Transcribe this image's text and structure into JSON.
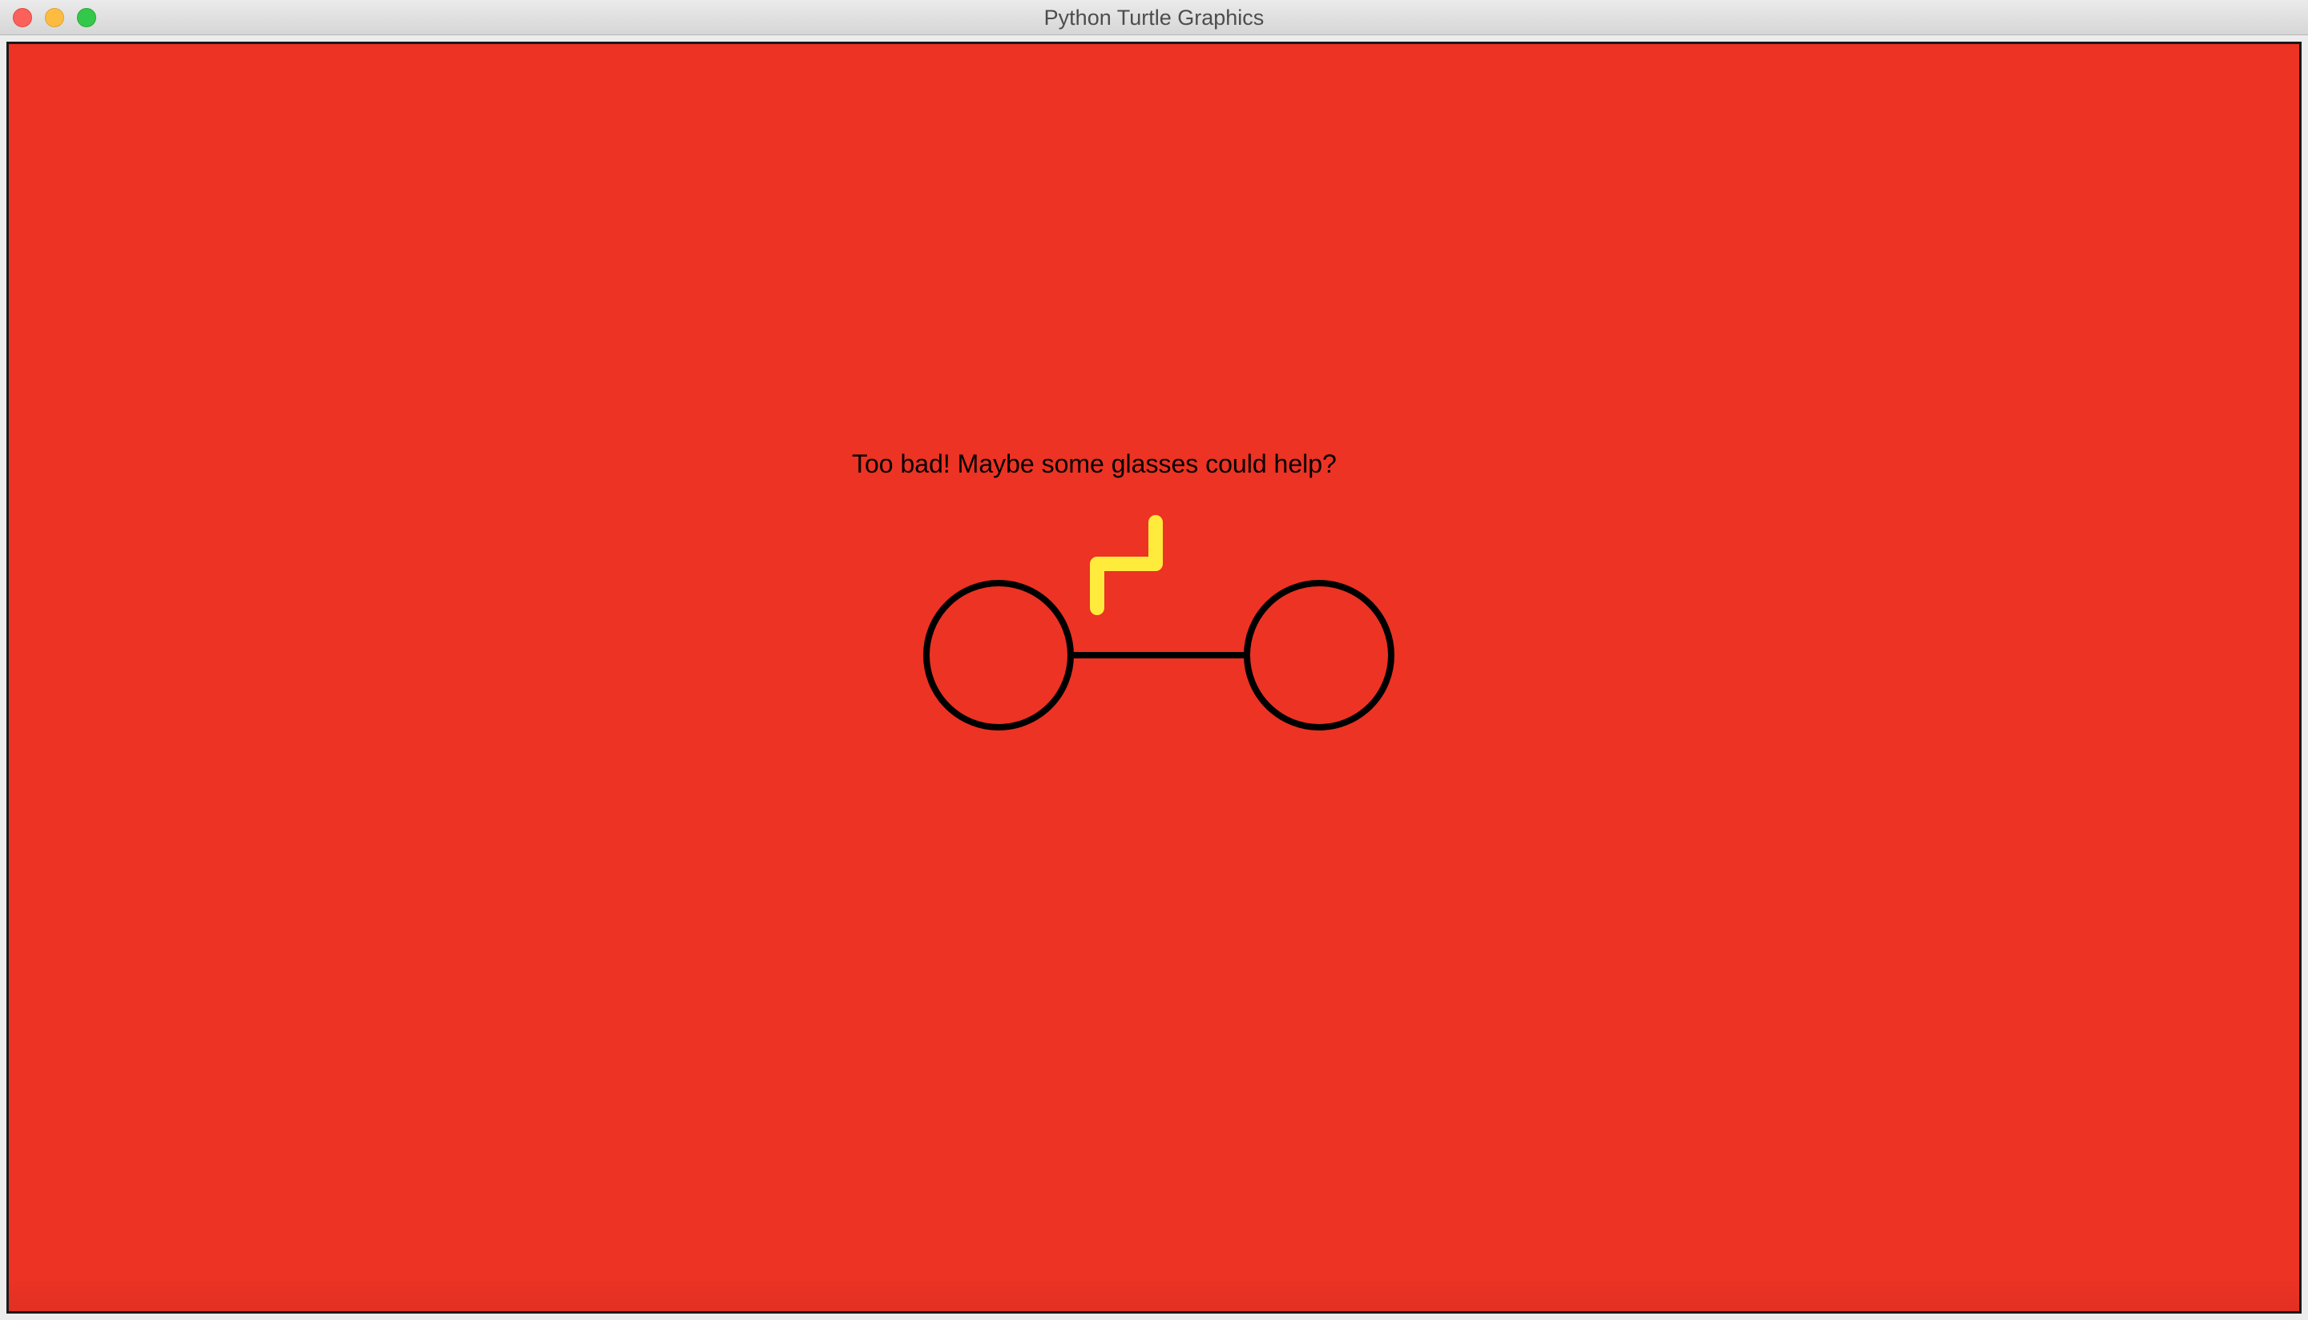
{
  "window": {
    "title": "Python Turtle Graphics",
    "buttons": {
      "close": "close",
      "minimize": "minimize",
      "zoom": "zoom"
    }
  },
  "canvas": {
    "background_color": "#ec3324",
    "message": "Too bad! Maybe some glasses could help?",
    "glasses_color": "#000000",
    "lightning_color": "#ffeb3b",
    "icons": [
      "glasses-icon",
      "lightning-bolt-icon"
    ]
  }
}
